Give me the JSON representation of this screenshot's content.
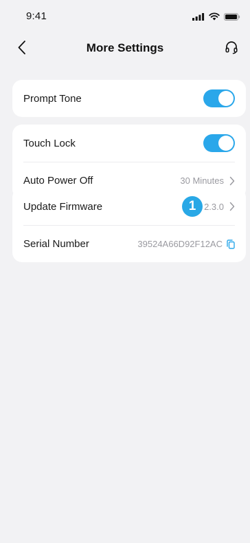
{
  "status_bar": {
    "time": "9:41"
  },
  "nav": {
    "title": "More Settings"
  },
  "settings": {
    "prompt_tone": {
      "label": "Prompt Tone",
      "enabled": true
    },
    "touch_lock": {
      "label": "Touch Lock",
      "enabled": true
    },
    "auto_power_off": {
      "label": "Auto Power Off",
      "value": "30 Minutes"
    },
    "update_firmware": {
      "label": "Update Firmware",
      "value": "2.3.0",
      "badge": "1"
    },
    "serial_number": {
      "label": "Serial Number",
      "value": "39524A66D92F12AC"
    }
  },
  "icons": {
    "back": "chevron-left-icon",
    "support": "headphones-icon",
    "chevron": "chevron-right-icon",
    "copy": "copy-icon"
  },
  "colors": {
    "accent": "#2aa7ea",
    "background": "#f2f2f4",
    "card": "#ffffff",
    "secondary_text": "#9a9aa0"
  }
}
